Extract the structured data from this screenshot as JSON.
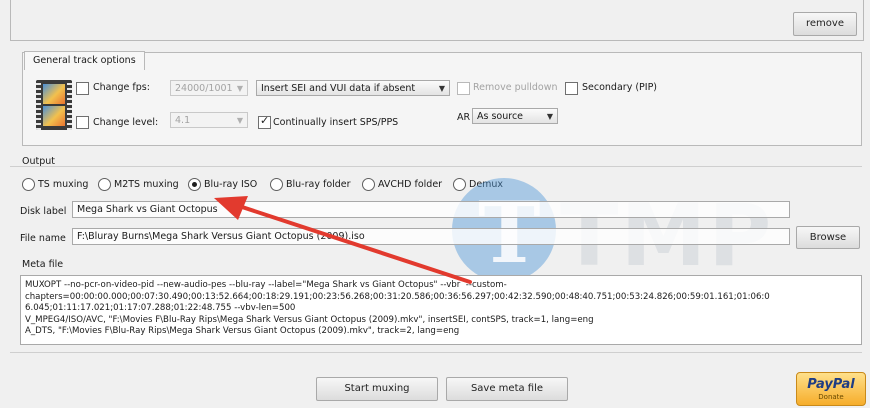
{
  "top": {
    "remove_label": "remove"
  },
  "general_track": {
    "tab_label": "General track options",
    "change_fps_label": "Change fps:",
    "fps_value": "24000/1001",
    "sei_option": "Insert SEI and VUI data if absent",
    "remove_pulldown_label": "Remove pulldown",
    "secondary_label": "Secondary (PIP)",
    "change_level_label": "Change level:",
    "level_value": "4.1",
    "continually_label": "Continually insert SPS/PPS",
    "ar_label": "AR",
    "ar_value": "As source"
  },
  "output": {
    "group_label": "Output",
    "options": [
      "TS muxing",
      "M2TS muxing",
      "Blu-ray ISO",
      "Blu-ray folder",
      "AVCHD folder",
      "Demux"
    ],
    "selected": "Blu-ray ISO",
    "disk_label_caption": "Disk label",
    "disk_label_value": "Mega Shark vs Giant Octopus",
    "file_name_caption": "File name",
    "file_name_value": "F:\\Bluray Burns\\Mega Shark Versus Giant Octopus (2009).iso",
    "browse_label": "Browse"
  },
  "meta": {
    "label": "Meta file",
    "lines": [
      "MUXOPT --no-pcr-on-video-pid --new-audio-pes --blu-ray --label=\"Mega Shark vs Giant Octopus\" --vbr  --custom-",
      "chapters=00:00:00.000;00:07:30.490;00:13:52.664;00:18:29.191;00:23:56.268;00:31:20.586;00:36:56.297;00:42:32.590;00:48:40.751;00:53:24.826;00:59:01.161;01:06:0",
      "6.045;01:11:17.021;01:17:07.288;01:22:48.755 --vbv-len=500",
      "V_MPEG4/ISO/AVC, \"F:\\Movies F\\Blu-Ray Rips\\Mega Shark Versus Giant Octopus (2009).mkv\", insertSEI, contSPS, track=1, lang=eng",
      "A_DTS, \"F:\\Movies F\\Blu-Ray Rips\\Mega Shark Versus Giant Octopus (2009).mkv\", track=2, lang=eng"
    ]
  },
  "bottom": {
    "start_label": "Start muxing",
    "save_label": "Save meta file",
    "paypal_label": "PayPal",
    "paypal_sub": "Donate"
  },
  "watermark": {
    "text": "TMP",
    "letter": "T"
  },
  "colors": {
    "arrow": "#e23a2e",
    "paypal": "#f6ad2b",
    "watermark_blue": "#4f96d7"
  }
}
